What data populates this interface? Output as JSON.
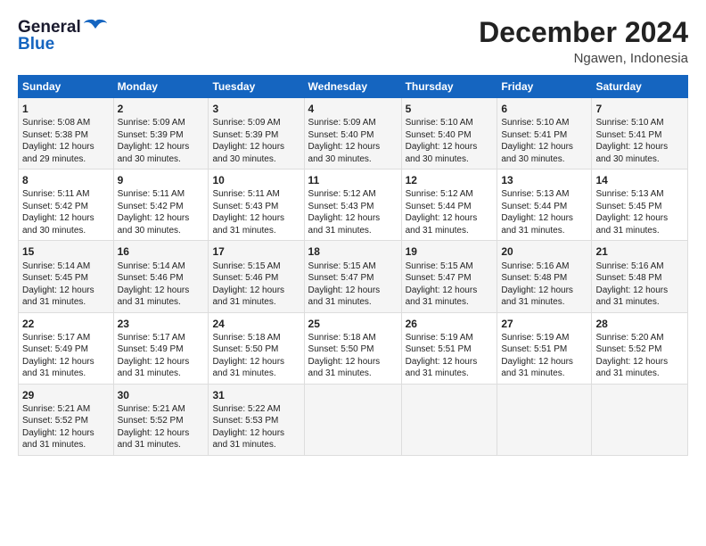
{
  "header": {
    "logo_general": "General",
    "logo_blue": "Blue",
    "month": "December 2024",
    "location": "Ngawen, Indonesia"
  },
  "weekdays": [
    "Sunday",
    "Monday",
    "Tuesday",
    "Wednesday",
    "Thursday",
    "Friday",
    "Saturday"
  ],
  "weeks": [
    [
      {
        "day": "1",
        "lines": [
          "Sunrise: 5:08 AM",
          "Sunset: 5:38 PM",
          "Daylight: 12 hours",
          "and 29 minutes."
        ]
      },
      {
        "day": "2",
        "lines": [
          "Sunrise: 5:09 AM",
          "Sunset: 5:39 PM",
          "Daylight: 12 hours",
          "and 30 minutes."
        ]
      },
      {
        "day": "3",
        "lines": [
          "Sunrise: 5:09 AM",
          "Sunset: 5:39 PM",
          "Daylight: 12 hours",
          "and 30 minutes."
        ]
      },
      {
        "day": "4",
        "lines": [
          "Sunrise: 5:09 AM",
          "Sunset: 5:40 PM",
          "Daylight: 12 hours",
          "and 30 minutes."
        ]
      },
      {
        "day": "5",
        "lines": [
          "Sunrise: 5:10 AM",
          "Sunset: 5:40 PM",
          "Daylight: 12 hours",
          "and 30 minutes."
        ]
      },
      {
        "day": "6",
        "lines": [
          "Sunrise: 5:10 AM",
          "Sunset: 5:41 PM",
          "Daylight: 12 hours",
          "and 30 minutes."
        ]
      },
      {
        "day": "7",
        "lines": [
          "Sunrise: 5:10 AM",
          "Sunset: 5:41 PM",
          "Daylight: 12 hours",
          "and 30 minutes."
        ]
      }
    ],
    [
      {
        "day": "8",
        "lines": [
          "Sunrise: 5:11 AM",
          "Sunset: 5:42 PM",
          "Daylight: 12 hours",
          "and 30 minutes."
        ]
      },
      {
        "day": "9",
        "lines": [
          "Sunrise: 5:11 AM",
          "Sunset: 5:42 PM",
          "Daylight: 12 hours",
          "and 30 minutes."
        ]
      },
      {
        "day": "10",
        "lines": [
          "Sunrise: 5:11 AM",
          "Sunset: 5:43 PM",
          "Daylight: 12 hours",
          "and 31 minutes."
        ]
      },
      {
        "day": "11",
        "lines": [
          "Sunrise: 5:12 AM",
          "Sunset: 5:43 PM",
          "Daylight: 12 hours",
          "and 31 minutes."
        ]
      },
      {
        "day": "12",
        "lines": [
          "Sunrise: 5:12 AM",
          "Sunset: 5:44 PM",
          "Daylight: 12 hours",
          "and 31 minutes."
        ]
      },
      {
        "day": "13",
        "lines": [
          "Sunrise: 5:13 AM",
          "Sunset: 5:44 PM",
          "Daylight: 12 hours",
          "and 31 minutes."
        ]
      },
      {
        "day": "14",
        "lines": [
          "Sunrise: 5:13 AM",
          "Sunset: 5:45 PM",
          "Daylight: 12 hours",
          "and 31 minutes."
        ]
      }
    ],
    [
      {
        "day": "15",
        "lines": [
          "Sunrise: 5:14 AM",
          "Sunset: 5:45 PM",
          "Daylight: 12 hours",
          "and 31 minutes."
        ]
      },
      {
        "day": "16",
        "lines": [
          "Sunrise: 5:14 AM",
          "Sunset: 5:46 PM",
          "Daylight: 12 hours",
          "and 31 minutes."
        ]
      },
      {
        "day": "17",
        "lines": [
          "Sunrise: 5:15 AM",
          "Sunset: 5:46 PM",
          "Daylight: 12 hours",
          "and 31 minutes."
        ]
      },
      {
        "day": "18",
        "lines": [
          "Sunrise: 5:15 AM",
          "Sunset: 5:47 PM",
          "Daylight: 12 hours",
          "and 31 minutes."
        ]
      },
      {
        "day": "19",
        "lines": [
          "Sunrise: 5:15 AM",
          "Sunset: 5:47 PM",
          "Daylight: 12 hours",
          "and 31 minutes."
        ]
      },
      {
        "day": "20",
        "lines": [
          "Sunrise: 5:16 AM",
          "Sunset: 5:48 PM",
          "Daylight: 12 hours",
          "and 31 minutes."
        ]
      },
      {
        "day": "21",
        "lines": [
          "Sunrise: 5:16 AM",
          "Sunset: 5:48 PM",
          "Daylight: 12 hours",
          "and 31 minutes."
        ]
      }
    ],
    [
      {
        "day": "22",
        "lines": [
          "Sunrise: 5:17 AM",
          "Sunset: 5:49 PM",
          "Daylight: 12 hours",
          "and 31 minutes."
        ]
      },
      {
        "day": "23",
        "lines": [
          "Sunrise: 5:17 AM",
          "Sunset: 5:49 PM",
          "Daylight: 12 hours",
          "and 31 minutes."
        ]
      },
      {
        "day": "24",
        "lines": [
          "Sunrise: 5:18 AM",
          "Sunset: 5:50 PM",
          "Daylight: 12 hours",
          "and 31 minutes."
        ]
      },
      {
        "day": "25",
        "lines": [
          "Sunrise: 5:18 AM",
          "Sunset: 5:50 PM",
          "Daylight: 12 hours",
          "and 31 minutes."
        ]
      },
      {
        "day": "26",
        "lines": [
          "Sunrise: 5:19 AM",
          "Sunset: 5:51 PM",
          "Daylight: 12 hours",
          "and 31 minutes."
        ]
      },
      {
        "day": "27",
        "lines": [
          "Sunrise: 5:19 AM",
          "Sunset: 5:51 PM",
          "Daylight: 12 hours",
          "and 31 minutes."
        ]
      },
      {
        "day": "28",
        "lines": [
          "Sunrise: 5:20 AM",
          "Sunset: 5:52 PM",
          "Daylight: 12 hours",
          "and 31 minutes."
        ]
      }
    ],
    [
      {
        "day": "29",
        "lines": [
          "Sunrise: 5:21 AM",
          "Sunset: 5:52 PM",
          "Daylight: 12 hours",
          "and 31 minutes."
        ]
      },
      {
        "day": "30",
        "lines": [
          "Sunrise: 5:21 AM",
          "Sunset: 5:52 PM",
          "Daylight: 12 hours",
          "and 31 minutes."
        ]
      },
      {
        "day": "31",
        "lines": [
          "Sunrise: 5:22 AM",
          "Sunset: 5:53 PM",
          "Daylight: 12 hours",
          "and 31 minutes."
        ]
      },
      {
        "day": "",
        "lines": []
      },
      {
        "day": "",
        "lines": []
      },
      {
        "day": "",
        "lines": []
      },
      {
        "day": "",
        "lines": []
      }
    ]
  ]
}
